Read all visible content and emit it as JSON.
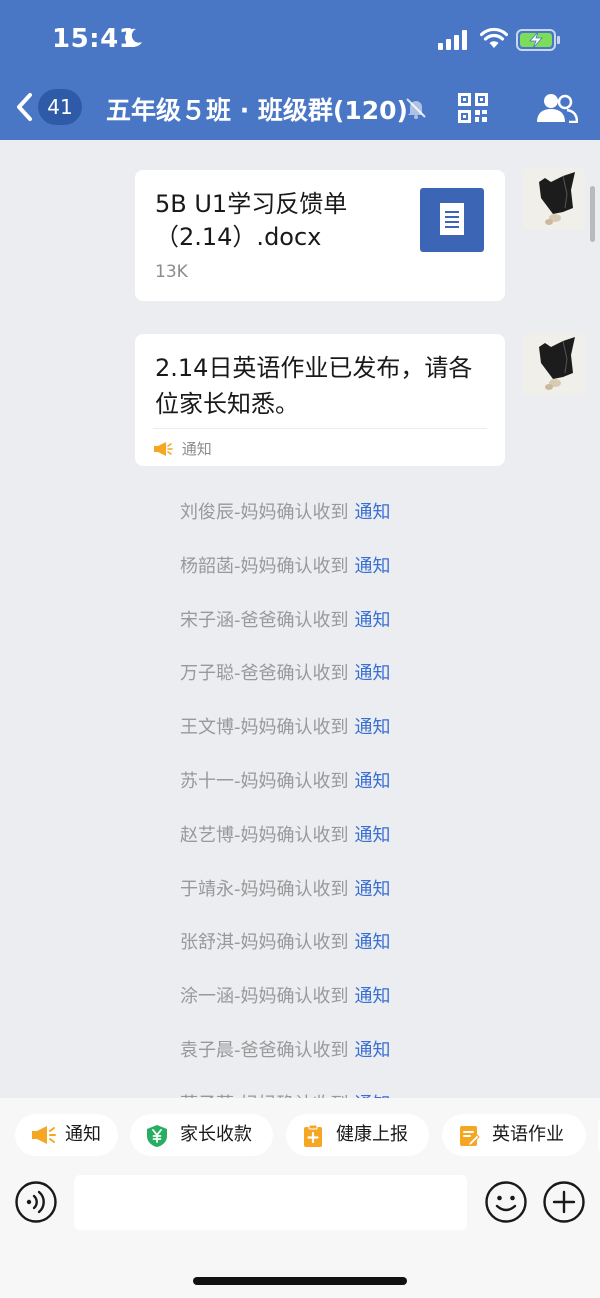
{
  "status_bar": {
    "time": "15:41"
  },
  "header": {
    "unread_count": "41",
    "title": "五年级５班 · 班级群(120)"
  },
  "messages": [
    {
      "type": "file",
      "name": "5B U1学习反馈单（2.14）.docx",
      "size": "13K"
    },
    {
      "type": "notice",
      "text": "2.14日英语作业已发布，请各位家长知悉。",
      "tag": "通知"
    }
  ],
  "confirmations": {
    "link_label": "通知",
    "items": [
      "刘俊辰-妈妈确认收到",
      "杨韶菡-妈妈确认收到",
      "宋子涵-爸爸确认收到",
      "万子聪-爸爸确认收到",
      "王文博-妈妈确认收到",
      "苏十一-妈妈确认收到",
      "赵艺博-妈妈确认收到",
      "于靖永-妈妈确认收到",
      "张舒淇-妈妈确认收到",
      "涂一涵-妈妈确认收到",
      "袁子晨-爸爸确认收到",
      "葉子菡-妈妈确认收到"
    ]
  },
  "quick_actions": [
    {
      "label": "通知",
      "icon": "megaphone-icon"
    },
    {
      "label": "家长收款",
      "icon": "yen-shield-icon"
    },
    {
      "label": "健康上报",
      "icon": "clipboard-plus-icon"
    },
    {
      "label": "英语作业",
      "icon": "homework-icon"
    }
  ],
  "input": {
    "placeholder": ""
  },
  "colors": {
    "header_bg": "#4a76c6",
    "link": "#3a6fd2",
    "chat_bg": "#ebedf0"
  }
}
